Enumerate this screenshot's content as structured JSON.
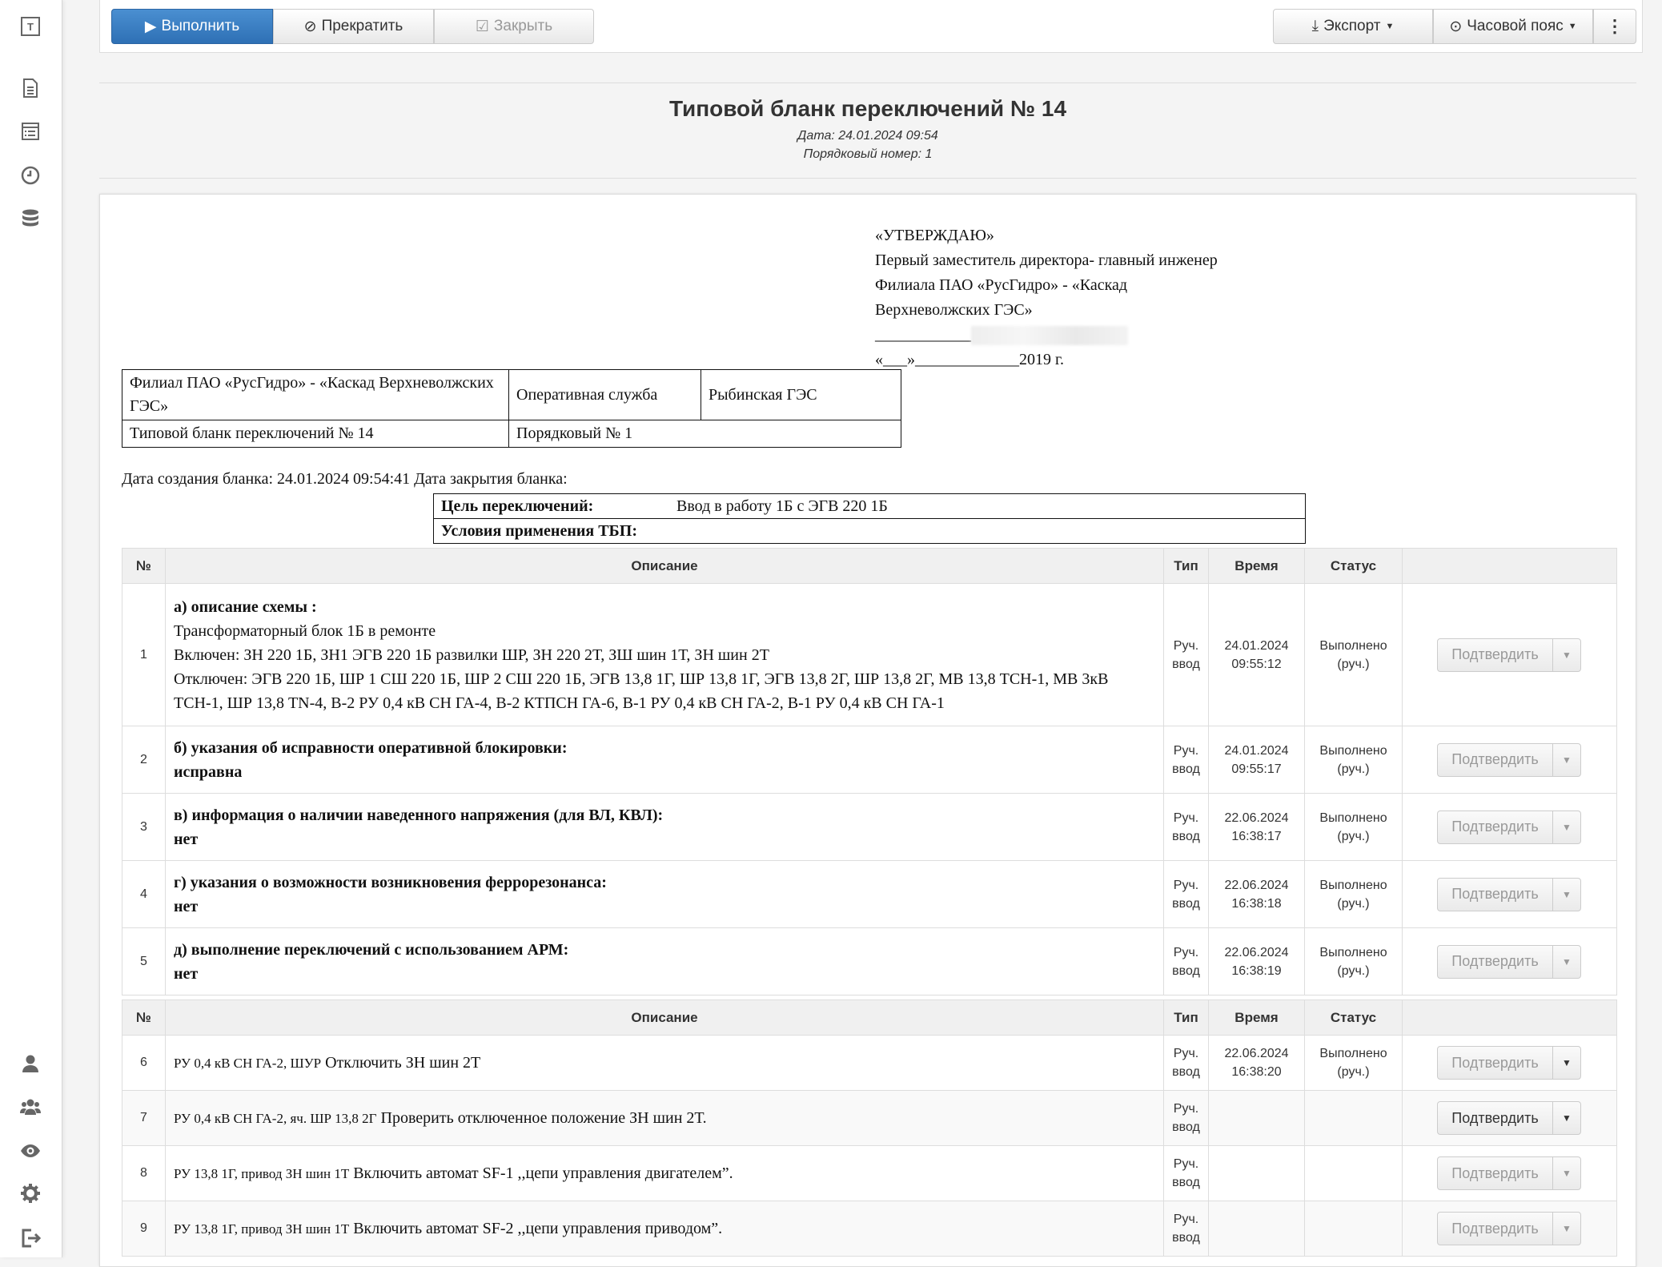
{
  "toolbar": {
    "run_label": "Выполнить",
    "stop_label": "Прекратить",
    "close_label": "Закрыть",
    "export_label": "Экспорт",
    "timezone_label": "Часовой пояс"
  },
  "header": {
    "title": "Типовой бланк переключений № 14",
    "date_line": "Дата: 24.01.2024 09:54",
    "seq_line": "Порядковый номер: 1"
  },
  "approval": {
    "line1": "«УТВЕРЖДАЮ»",
    "line2": "Первый заместитель директора- главный инженер",
    "line3": "Филиала ПАО «РусГидро» - «Каскад",
    "line4": "Верхневолжских ГЭС»",
    "sign_line": "____________",
    "date_line": "«___»_____________2019 г."
  },
  "org": {
    "branch": "Филиал ПАО «РусГидро» - «Каскад Верхневолжских ГЭС»",
    "service": "Оперативная служба",
    "station": "Рыбинская ГЭС",
    "form": "Типовой бланк переключений № 14",
    "seq": "Порядковый № 1"
  },
  "created_line": "Дата создания бланка: 24.01.2024 09:54:41 Дата закрытия бланка:",
  "goal": {
    "goal_label": "Цель переключений:",
    "goal_value": "Ввод в работу 1Б с ЭГВ 220 1Б",
    "cond_label": "Условия применения ТБП:"
  },
  "columns": {
    "num": "№",
    "desc": "Описание",
    "type": "Тип",
    "time": "Время",
    "status": "Статус"
  },
  "confirm_label": "Подтвердить",
  "section1": [
    {
      "num": "1",
      "title": "а) описание схемы :",
      "lines": [
        "Трансформаторный блок 1Б в ремонте",
        "Включен: ЗН 220 1Б, ЗН1 ЭГВ 220 1Б развилки ШР, ЗН 220 2Т, ЗШ шин 1Т, ЗН шин 2Т",
        "Отключен: ЭГВ 220 1Б, ШР 1 СШ 220 1Б, ШР 2 СШ 220 1Б, ЭГВ 13,8 1Г, ШР 13,8 1Г, ЭГВ 13,8 2Г, ШР 13,8 2Г, МВ 13,8 ТСН-1, МВ 3кВ ТСН-1, ШР 13,8 TN-4, В-2 РУ 0,4 кВ СН ГА-4, В-2 КТПСН ГА-6, В-1 РУ 0,4 кВ СН ГА-2, В-1 РУ 0,4 кВ СН ГА-1"
      ],
      "type": "Руч. ввод",
      "time": "24.01.2024 09:55:12",
      "status": "Выполнено (руч.)"
    },
    {
      "num": "2",
      "title": "б) указания об исправности оперативной блокировки:",
      "lines": [
        "исправна"
      ],
      "type": "Руч. ввод",
      "time": "24.01.2024 09:55:17",
      "status": "Выполнено (руч.)"
    },
    {
      "num": "3",
      "title": "в) информация о наличии наведенного напряжения (для ВЛ, КВЛ):",
      "lines": [
        "нет"
      ],
      "type": "Руч. ввод",
      "time": "22.06.2024 16:38:17",
      "status": "Выполнено (руч.)"
    },
    {
      "num": "4",
      "title": "г) указания о возможности возникновения феррорезонанса:",
      "lines": [
        "нет"
      ],
      "type": "Руч. ввод",
      "time": "22.06.2024 16:38:18",
      "status": "Выполнено (руч.)"
    },
    {
      "num": "5",
      "title": "д) выполнение переключений с использованием АРМ:",
      "lines": [
        "нет"
      ],
      "type": "Руч. ввод",
      "time": "22.06.2024 16:38:19",
      "status": "Выполнено (руч.)"
    }
  ],
  "section2": [
    {
      "num": "6",
      "loc": "РУ 0,4 кВ СН ГА-2, ШУР",
      "text": "Отключить ЗН шин 2Т",
      "type": "Руч. ввод",
      "time": "22.06.2024 16:38:20",
      "status": "Выполнено (руч.)"
    },
    {
      "num": "7",
      "loc": "РУ 0,4 кВ СН ГА-2, яч. ШР 13,8 2Г",
      "text": "Проверить отключенное положение ЗН шин 2Т.",
      "type": "Руч. ввод",
      "time": "",
      "status": ""
    },
    {
      "num": "8",
      "loc": "РУ 13,8 1Г, привод ЗН шин 1Т",
      "text": "Включить автомат SF-1 ,,цепи управления двигателем”.",
      "type": "Руч. ввод",
      "time": "",
      "status": ""
    },
    {
      "num": "9",
      "loc": "РУ 13,8 1Г, привод ЗН шин 1Т",
      "text": "Включить автомат SF-2 ,,цепи управления приводом”.",
      "type": "Руч. ввод",
      "time": "",
      "status": ""
    }
  ]
}
